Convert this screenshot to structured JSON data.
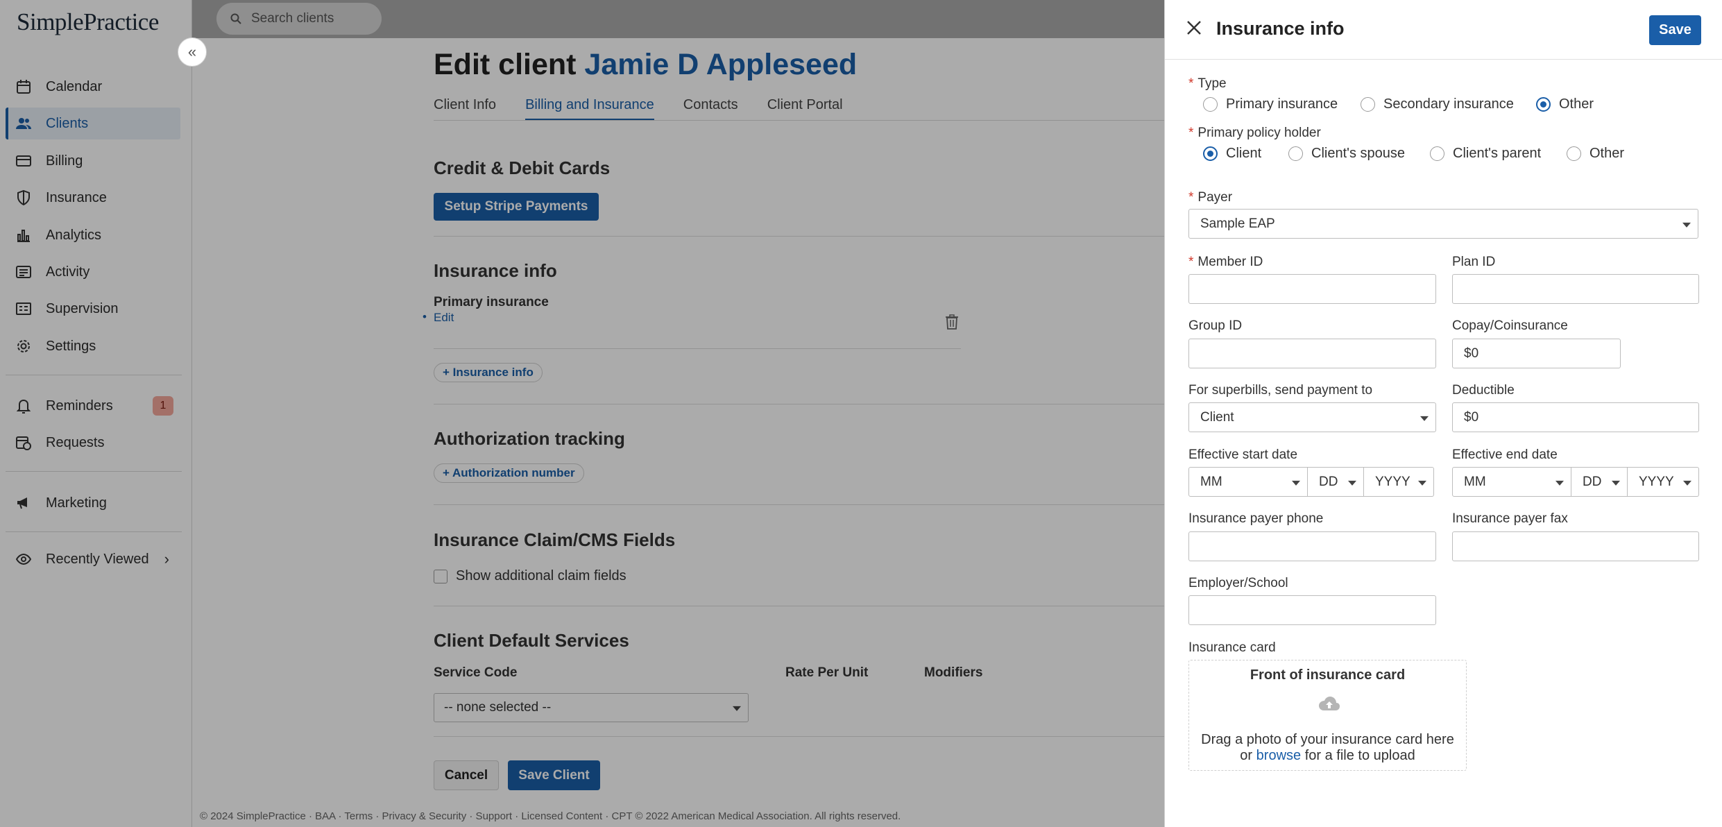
{
  "app": {
    "logo": "SimplePractice"
  },
  "search": {
    "placeholder": "Search clients"
  },
  "sidebar": {
    "items": [
      {
        "label": "Calendar",
        "icon": "calendar-icon"
      },
      {
        "label": "Clients",
        "icon": "clients-icon",
        "active": true
      },
      {
        "label": "Billing",
        "icon": "billing-card-icon"
      },
      {
        "label": "Insurance",
        "icon": "shield-icon"
      },
      {
        "label": "Analytics",
        "icon": "bar-chart-icon"
      },
      {
        "label": "Activity",
        "icon": "activity-list-icon"
      },
      {
        "label": "Supervision",
        "icon": "supervision-icon"
      },
      {
        "label": "Settings",
        "icon": "gear-icon"
      },
      {
        "label": "Reminders",
        "icon": "bell-icon",
        "badge": "1"
      },
      {
        "label": "Requests",
        "icon": "requests-icon"
      },
      {
        "label": "Marketing",
        "icon": "megaphone-icon"
      },
      {
        "label": "Recently Viewed",
        "icon": "eye-icon"
      }
    ]
  },
  "page": {
    "title_prefix": "Edit client",
    "client_name": "Jamie D Appleseed",
    "tabs": [
      "Client Info",
      "Billing and Insurance",
      "Contacts",
      "Client Portal"
    ],
    "active_tab": "Billing and Insurance"
  },
  "cards": {
    "title": "Credit & Debit Cards",
    "button": "Setup Stripe Payments"
  },
  "insurance": {
    "title": "Insurance info",
    "primary_label": "Primary insurance",
    "edit_link": "Edit",
    "add_button": "+ Insurance info"
  },
  "authorization": {
    "title": "Authorization tracking",
    "add_button": "+ Authorization number"
  },
  "claim": {
    "title": "Insurance Claim/CMS Fields",
    "checkbox_label": "Show additional claim fields"
  },
  "services": {
    "title": "Client Default Services",
    "columns": [
      "Service Code",
      "Rate Per Unit",
      "Modifiers"
    ],
    "select_value": "-- none selected --"
  },
  "form_actions": {
    "cancel": "Cancel",
    "save": "Save Client"
  },
  "footer": "© 2024 SimplePractice · BAA · Terms · Privacy & Security · Support · Licensed Content · CPT © 2022 American Medical Association. All rights reserved.",
  "panel": {
    "title": "Insurance info",
    "save": "Save",
    "type": {
      "label": "Type",
      "options": [
        "Primary insurance",
        "Secondary insurance",
        "Other"
      ],
      "selected": "Other"
    },
    "policy_holder": {
      "label": "Primary policy holder",
      "options": [
        "Client",
        "Client's spouse",
        "Client's parent",
        "Other"
      ],
      "selected": "Client"
    },
    "payer": {
      "label": "Payer",
      "value": "Sample EAP"
    },
    "member_id": {
      "label": "Member ID",
      "value": ""
    },
    "plan_id": {
      "label": "Plan ID",
      "value": ""
    },
    "group_id": {
      "label": "Group ID",
      "value": ""
    },
    "copay": {
      "label": "Copay/Coinsurance",
      "value": "$0"
    },
    "superbills": {
      "label": "For superbills, send payment to",
      "value": "Client"
    },
    "deductible": {
      "label": "Deductible",
      "value": "$0"
    },
    "start_date": {
      "label": "Effective start date",
      "mm": "MM",
      "dd": "DD",
      "yyyy": "YYYY"
    },
    "end_date": {
      "label": "Effective end date",
      "mm": "MM",
      "dd": "DD",
      "yyyy": "YYYY"
    },
    "payer_phone": {
      "label": "Insurance payer phone",
      "value": ""
    },
    "payer_fax": {
      "label": "Insurance payer fax",
      "value": ""
    },
    "employer": {
      "label": "Employer/School",
      "value": ""
    },
    "card": {
      "label": "Insurance card",
      "front_title": "Front of insurance card",
      "drag_text": "Drag a photo of your insurance card here",
      "or_text": "or",
      "browse": "browse",
      "upload_text": "for a file to upload"
    }
  },
  "colors": {
    "accent": "#1a5ea8",
    "required": "#d0392b",
    "badge": "#f4a79c"
  }
}
